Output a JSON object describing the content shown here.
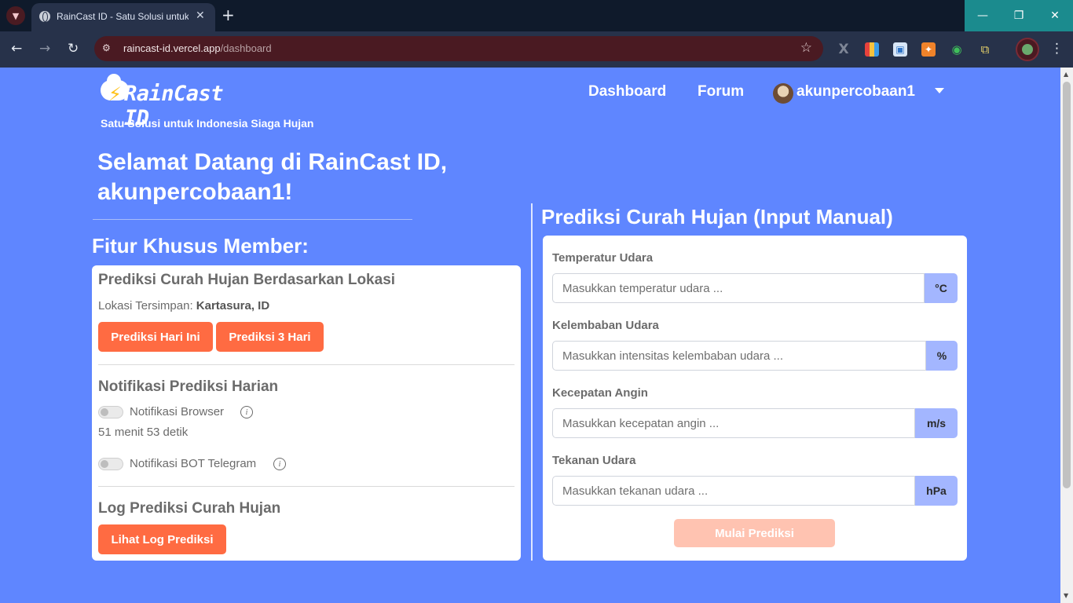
{
  "browser": {
    "tab_title": "RainCast ID - Satu Solusi untuk",
    "url_host": "raincast-id.vercel.app",
    "url_path": "/dashboard"
  },
  "header": {
    "logo_text": "RainCast ID",
    "tagline": "Satu Solusi untuk Indonesia Siaga Hujan",
    "nav_dashboard": "Dashboard",
    "nav_forum": "Forum",
    "username": "akunpercobaan1"
  },
  "welcome": {
    "line1": "Selamat Datang di RainCast ID,",
    "line2": "akunpercobaan1!"
  },
  "features": {
    "heading": "Fitur Khusus Member:",
    "location": {
      "title": "Prediksi Curah Hujan Berdasarkan Lokasi",
      "saved_label": "Lokasi Tersimpan:",
      "saved_value": "Kartasura, ID",
      "btn_today": "Prediksi Hari Ini",
      "btn_3days": "Prediksi 3 Hari"
    },
    "notifications": {
      "title": "Notifikasi Prediksi Harian",
      "browser_label": "Notifikasi Browser",
      "countdown": "51 menit 53 detik",
      "telegram_label": "Notifikasi BOT Telegram"
    },
    "log": {
      "title": "Log Prediksi Curah Hujan",
      "btn_view": "Lihat Log Prediksi"
    }
  },
  "manual": {
    "heading": "Prediksi Curah Hujan (Input Manual)",
    "fields": [
      {
        "label": "Temperatur Udara",
        "placeholder": "Masukkan temperatur udara ...",
        "unit": "°C"
      },
      {
        "label": "Kelembaban Udara",
        "placeholder": "Masukkan intensitas kelembaban udara ...",
        "unit": "%"
      },
      {
        "label": "Kecepatan Angin",
        "placeholder": "Masukkan kecepatan angin ...",
        "unit": "m/s"
      },
      {
        "label": "Tekanan Udara",
        "placeholder": "Masukkan tekanan udara ...",
        "unit": "hPa"
      }
    ],
    "submit": "Mulai Prediksi"
  },
  "colors": {
    "page_bg": "#5f86ff",
    "accent_orange": "#ff6b42",
    "addon_blue": "#a3b6ff"
  }
}
